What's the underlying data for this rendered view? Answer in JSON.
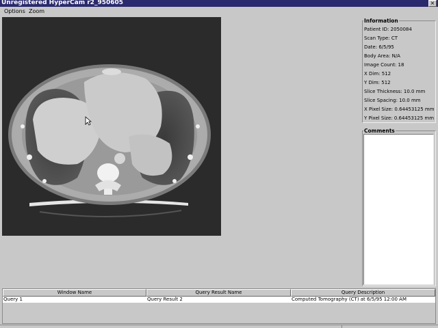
{
  "window": {
    "title": "Unregistered HyperCam r2_950605",
    "close_glyph": "×"
  },
  "menubar": {
    "items": [
      "Options",
      "Zoom"
    ]
  },
  "viewer": {
    "image_type": "CT axial slice"
  },
  "information": {
    "label": "Information",
    "lines": [
      "Patient ID: 2050084",
      "Scan Type: CT",
      "Date: 6/5/95",
      "Body Area: N/A",
      "Image Count: 18",
      "X Dim: 512",
      "Y Dim: 512",
      "Slice Thickness: 10.0 mm",
      "Slice Spacing: 10.0 mm",
      "X Pixel Size: 0.64453125 mm",
      "Y Pixel Size: 0.64453125 mm"
    ]
  },
  "comments": {
    "label": "Comments",
    "value": ""
  },
  "results_table": {
    "columns": [
      "Window Name",
      "Query Result Name",
      "Query Description"
    ],
    "rows": [
      [
        "Query 1",
        "Query Result 2",
        "Computed Tomography (CT) at 6/5/95 12:00 AM"
      ]
    ]
  }
}
